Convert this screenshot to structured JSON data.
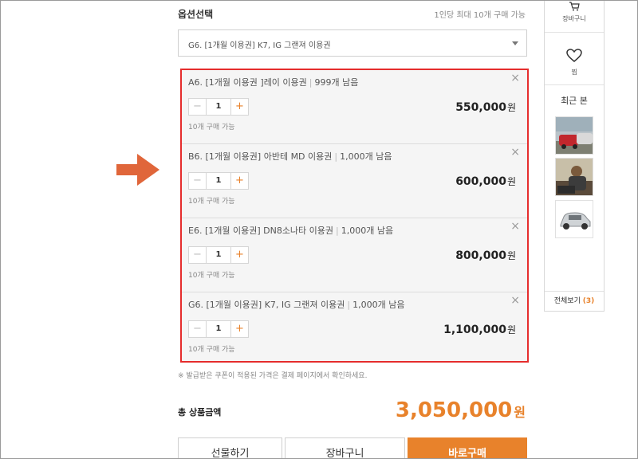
{
  "options": {
    "title": "옵션선택",
    "limit_text": "1인당 최대 10개 구매 가능",
    "selected": "G6. [1개월 이용권] K7, IG 그랜져 이용권"
  },
  "items": [
    {
      "name": "A6. [1개월 이용권 ]레이 이용권",
      "stock": "999개 남음",
      "qty": "1",
      "limit": "10개 구매 가능",
      "price": "550,000",
      "won": "원"
    },
    {
      "name": "B6. [1개월 이용권] 아반테 MD 이용권",
      "stock": "1,000개 남음",
      "qty": "1",
      "limit": "10개 구매 가능",
      "price": "600,000",
      "won": "원"
    },
    {
      "name": "E6. [1개월 이용권] DN8소나타 이용권",
      "stock": "1,000개 남음",
      "qty": "1",
      "limit": "10개 구매 가능",
      "price": "800,000",
      "won": "원"
    },
    {
      "name": "G6. [1개월 이용권] K7, IG 그랜져 이용권",
      "stock": "1,000개 남음",
      "qty": "1",
      "limit": "10개 구매 가능",
      "price": "1,100,000",
      "won": "원"
    }
  ],
  "stepper": {
    "minus": "−",
    "plus": "+"
  },
  "close_symbol": "×",
  "note": "※ 발급받은 쿠폰이 적용된 가격은 결제 페이지에서 확인하세요.",
  "total": {
    "label": "총 상품금액",
    "price": "3,050,000",
    "won": "원"
  },
  "buttons": {
    "gift": "선물하기",
    "cart": "장바구니",
    "buy": "바로구매"
  },
  "sidebar": {
    "cart_label": "장바구니",
    "wish_label": "찜",
    "recent_title": "최근 본",
    "view_all": "전체보기",
    "view_all_count": "(3)"
  },
  "colors": {
    "accent": "#e8822b",
    "highlight_border": "#e52d2d",
    "arrow": "#e0663a"
  },
  "icons": {
    "arrow": "arrow-right-icon",
    "cart": "cart-icon",
    "wish": "heart-icon",
    "close": "close-icon"
  }
}
